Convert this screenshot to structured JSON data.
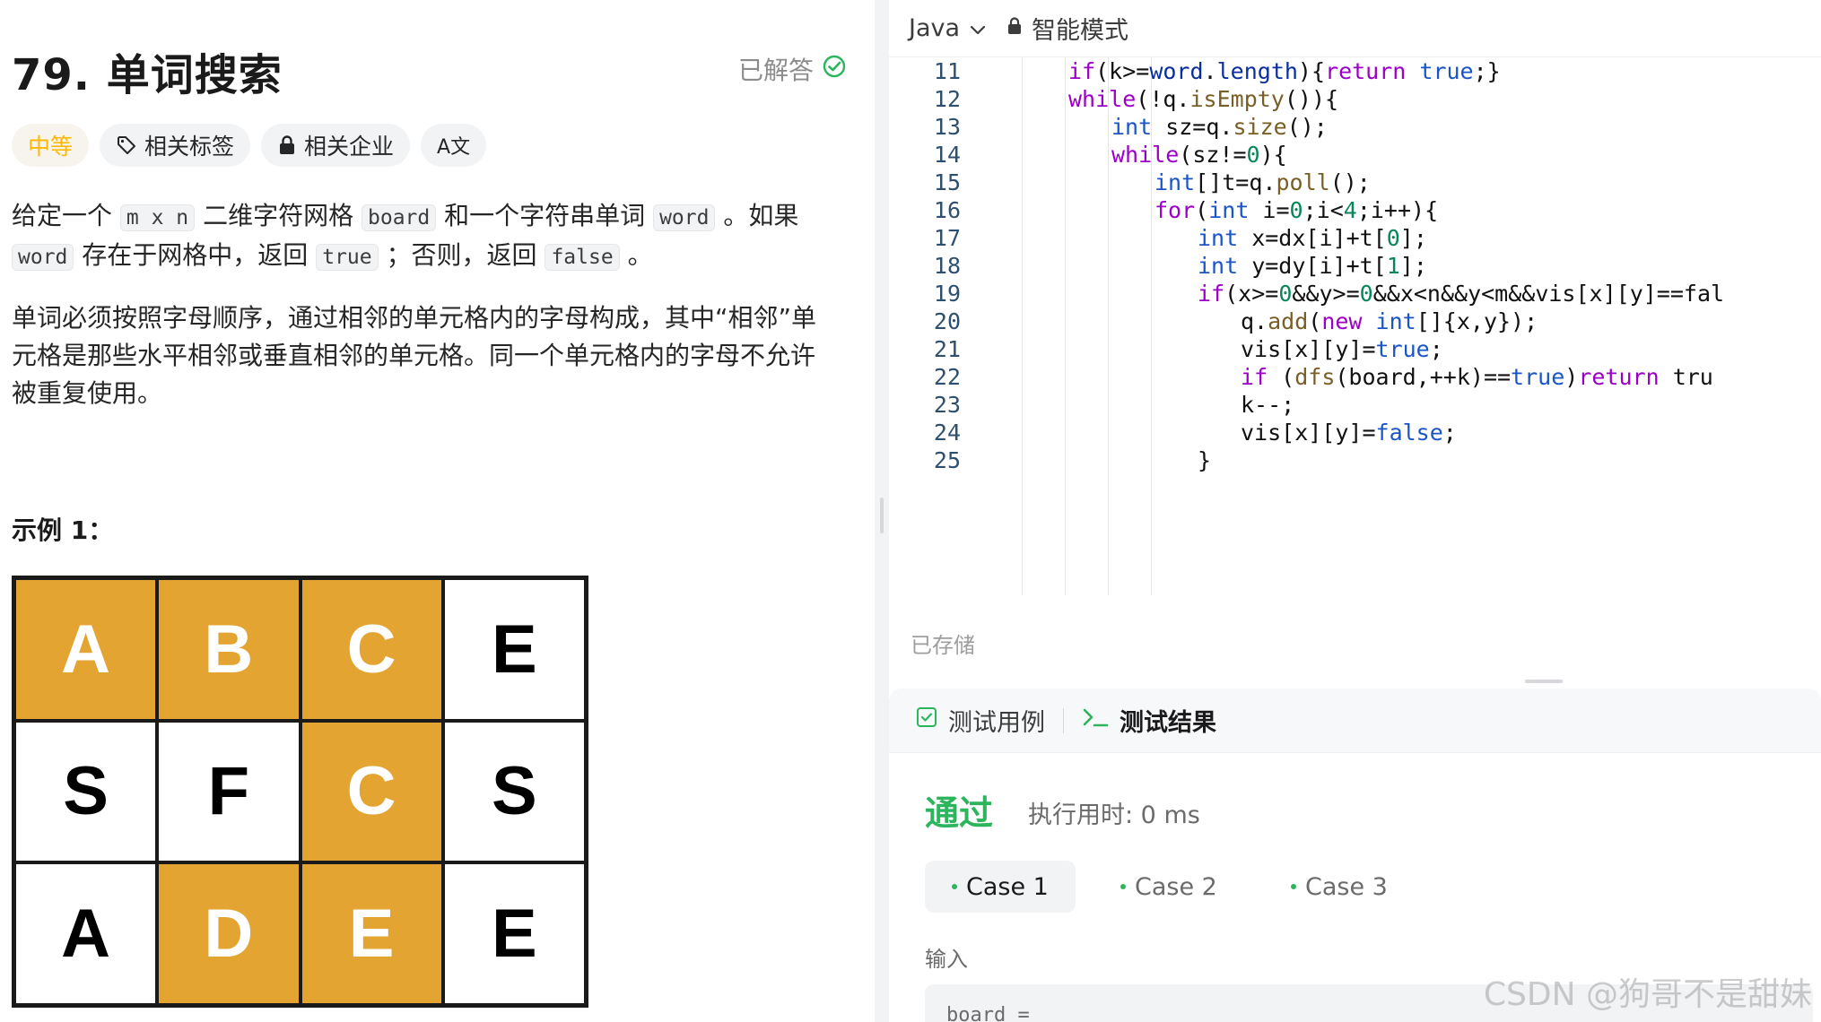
{
  "problem": {
    "title": "79. 单词搜索",
    "solved_label": "已解答",
    "tags": {
      "difficulty": "中等",
      "related_tags": "相关标签",
      "related_companies": "相关企业",
      "translate": "A文"
    },
    "desc1": {
      "t1": "给定一个",
      "c1": "m x n",
      "t2": "二维字符网格",
      "c2": "board",
      "t3": "和一个字符串单词",
      "c3": "word",
      "t4": "。如果",
      "c4": "word",
      "t5": "存在于网格中，返回",
      "c5": "true",
      "t6": "；否则，返回",
      "c6": "false",
      "t7": "。"
    },
    "desc2": "单词必须按照字母顺序，通过相邻的单元格内的字母构成，其中“相邻”单元格是那些水平相邻或垂直相邻的单元格。同一个单元格内的字母不允许被重复使用。",
    "example_title": "示例 1：",
    "grid": [
      [
        "A",
        "B",
        "C",
        "E"
      ],
      [
        "S",
        "F",
        "C",
        "S"
      ],
      [
        "A",
        "D",
        "E",
        "E"
      ]
    ],
    "grid_highlight": [
      [
        1,
        1,
        1,
        0
      ],
      [
        0,
        0,
        1,
        0
      ],
      [
        0,
        1,
        1,
        0
      ]
    ],
    "highlight_color": "#e3a431"
  },
  "editor": {
    "language": "Java",
    "mode": "智能模式",
    "saved_label": "已存储",
    "lines": [
      {
        "n": "11",
        "t": "if(k>=word.length){return true;}"
      },
      {
        "n": "12",
        "t": "while(!q.isEmpty()){"
      },
      {
        "n": "13",
        "t": "int sz=q.size();"
      },
      {
        "n": "14",
        "t": "while(sz!=0){"
      },
      {
        "n": "15",
        "t": "int[]t=q.poll();"
      },
      {
        "n": "16",
        "t": "for(int i=0;i<4;i++){"
      },
      {
        "n": "17",
        "t": "int x=dx[i]+t[0];"
      },
      {
        "n": "18",
        "t": "int y=dy[i]+t[1];"
      },
      {
        "n": "19",
        "t": "if(x>=0&&y>=0&&x<n&&y<m&&vis[x][y]==fal"
      },
      {
        "n": "20",
        "t": "q.add(new int[]{x,y});"
      },
      {
        "n": "21",
        "t": "vis[x][y]=true;"
      },
      {
        "n": "22",
        "t": "if (dfs(board,++k)==true)return tru"
      },
      {
        "n": "23",
        "t": "k--;"
      },
      {
        "n": "24",
        "t": "vis[x][y]=false;"
      },
      {
        "n": "25",
        "t": "}"
      }
    ]
  },
  "tests": {
    "tab_cases": "测试用例",
    "tab_result": "测试结果",
    "status": "通过",
    "runtime": "执行用时: 0 ms",
    "cases": [
      "Case 1",
      "Case 2",
      "Case 3"
    ],
    "input_label": "输入",
    "input_value": "board ="
  },
  "watermark": "CSDN @狗哥不是甜妹"
}
